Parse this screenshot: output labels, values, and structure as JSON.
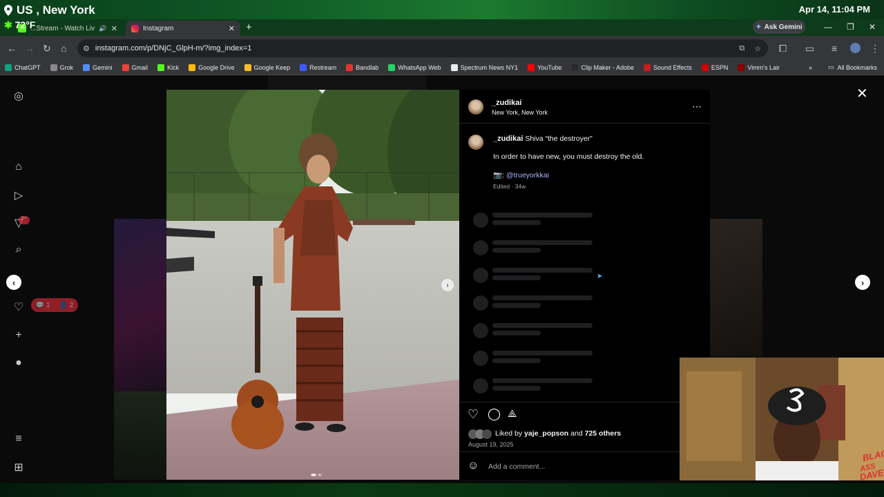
{
  "overlay": {
    "location": "US , New York",
    "datetime": "Apr 14, 11:04 PM",
    "weather": "72°F"
  },
  "tabs": [
    {
      "label": "...Stream - Watch Liv"
    },
    {
      "label": "Instagram"
    }
  ],
  "ask_gemini": "Ask Gemini",
  "url": "instagram.com/p/DNjC_GlpH-m/?img_index=1",
  "bookmarks": [
    {
      "label": "ChatGPT",
      "color": "#10a37f"
    },
    {
      "label": "Grok",
      "color": "#888888"
    },
    {
      "label": "Gemini",
      "color": "#4e8df5"
    },
    {
      "label": "Gmail",
      "color": "#ea4335"
    },
    {
      "label": "Kick",
      "color": "#53fc18"
    },
    {
      "label": "Google Drive",
      "color": "#fbbc04"
    },
    {
      "label": "Google Keep",
      "color": "#f6bf26"
    },
    {
      "label": "Restream",
      "color": "#3c5bff"
    },
    {
      "label": "Bandlab",
      "color": "#e5342b"
    },
    {
      "label": "WhatsApp Web",
      "color": "#25d366"
    },
    {
      "label": "Spectrum News NY1",
      "color": "#e8eaed"
    },
    {
      "label": "YouTube",
      "color": "#ff0000"
    },
    {
      "label": "Clip Maker - Adobe",
      "color": "#2a2a2a"
    },
    {
      "label": "Sound Effects",
      "color": "#c41e1e"
    },
    {
      "label": "ESPN",
      "color": "#d00000"
    },
    {
      "label": "Vimm's Lair",
      "color": "#8b0000"
    }
  ],
  "all_bookmarks": "All Bookmarks",
  "notifications": {
    "badge": "9+",
    "comments": "1",
    "follows": "2"
  },
  "post": {
    "username": "_zudikai",
    "location": "New York, New York",
    "caption_title": "Shiva “the destroyer”",
    "caption_body": "In order to have new, you must destroy the old.",
    "credit_prefix": "📷: ",
    "credit_handle": "@trueyorkkai",
    "edited": "Edited · 34w",
    "liked_by_prefix": "Liked by",
    "liked_by_user": "yaje_popson",
    "liked_by_and": "and",
    "liked_by_others": "725 others",
    "date": "August 19, 2025",
    "comment_placeholder": "Add a comment..."
  },
  "colors": {
    "accent_link": "#a8b8ff",
    "notif_red": "#ff3040"
  }
}
